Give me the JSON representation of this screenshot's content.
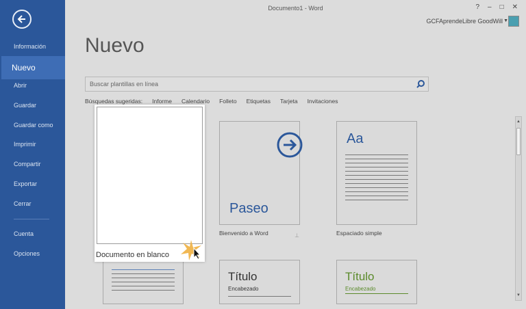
{
  "window": {
    "title": "Documento1 - Word",
    "controls": [
      "?",
      "–",
      "□",
      "✕"
    ]
  },
  "user": {
    "name": "GCFAprendeLibre GoodWill"
  },
  "sidebar": {
    "items": [
      {
        "label": "Información"
      },
      {
        "label": "Nuevo",
        "active": true
      },
      {
        "label": "Abrir"
      },
      {
        "label": "Guardar"
      },
      {
        "label": "Guardar como"
      },
      {
        "label": "Imprimir"
      },
      {
        "label": "Compartir"
      },
      {
        "label": "Exportar"
      },
      {
        "label": "Cerrar"
      },
      {
        "label": "Cuenta"
      },
      {
        "label": "Opciones"
      }
    ]
  },
  "main": {
    "title": "Nuevo",
    "search": {
      "placeholder": "Buscar plantillas en línea"
    },
    "suggested": {
      "label": "Búsquedas sugeridas:",
      "items": [
        "Informe",
        "Calendario",
        "Folleto",
        "Etiquetas",
        "Tarjeta",
        "Invitaciones"
      ]
    },
    "templates": {
      "blank": {
        "label": "Documento en blanco"
      },
      "tour": {
        "label": "Bienvenido a Word",
        "thumb_text": "Paseo"
      },
      "single": {
        "label": "Espaciado simple",
        "thumb_text": "Aa"
      },
      "title1": {
        "heading": "Título",
        "sub": "Encabezado"
      },
      "title2": {
        "heading": "Título",
        "sub": "Encabezado"
      }
    }
  },
  "colors": {
    "sidebar": "#2b579a",
    "sidebar_active": "#3e6db5",
    "accent_blue": "#2b579a",
    "accent_green": "#5a8a2a"
  }
}
